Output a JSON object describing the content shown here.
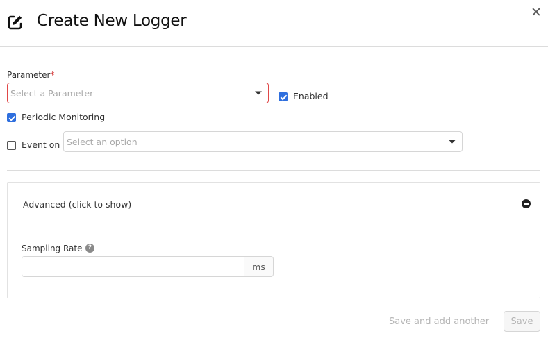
{
  "dialog": {
    "title": "Create New Logger",
    "close_glyph": "✕",
    "title_icon": "edit-icon"
  },
  "form": {
    "parameter": {
      "label": "Parameter",
      "required_mark": "*",
      "placeholder": "Select a Parameter"
    },
    "enabled": {
      "label": "Enabled",
      "checked": true
    },
    "periodic_monitoring": {
      "label": "Periodic Monitoring",
      "checked": true
    },
    "event_on": {
      "label": "Event on",
      "checked": false,
      "placeholder": "Select an option"
    }
  },
  "advanced": {
    "toggle_label": "Advanced (click to show)",
    "sampling_rate": {
      "label": "Sampling Rate",
      "help_glyph": "?",
      "value": "",
      "unit": "ms"
    }
  },
  "actions": {
    "save_and_add_label": "Save and add another",
    "save_label": "Save"
  },
  "colors": {
    "accent": "#2f6fde",
    "error_border": "#e04848",
    "disabled_text": "#b5b5b5"
  }
}
